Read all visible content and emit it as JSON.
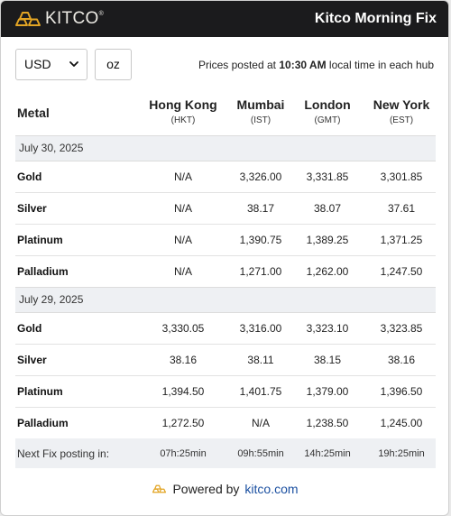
{
  "header": {
    "logo_text": "KITCO",
    "logo_mark": "®",
    "title": "Kitco Morning Fix"
  },
  "controls": {
    "currency": "USD",
    "unit": "oz",
    "notice_prefix": "Prices posted at ",
    "notice_time": "10:30 AM",
    "notice_suffix": " local time in each hub"
  },
  "table": {
    "metal_header": "Metal",
    "cities": [
      {
        "name": "Hong Kong",
        "tz": "(HKT)"
      },
      {
        "name": "Mumbai",
        "tz": "(IST)"
      },
      {
        "name": "London",
        "tz": "(GMT)"
      },
      {
        "name": "New York",
        "tz": "(EST)"
      }
    ],
    "groups": [
      {
        "date": "July 30, 2025",
        "rows": [
          {
            "metal": "Gold",
            "values": [
              "N/A",
              "3,326.00",
              "3,331.85",
              "3,301.85"
            ]
          },
          {
            "metal": "Silver",
            "values": [
              "N/A",
              "38.17",
              "38.07",
              "37.61"
            ]
          },
          {
            "metal": "Platinum",
            "values": [
              "N/A",
              "1,390.75",
              "1,389.25",
              "1,371.25"
            ]
          },
          {
            "metal": "Palladium",
            "values": [
              "N/A",
              "1,271.00",
              "1,262.00",
              "1,247.50"
            ]
          }
        ]
      },
      {
        "date": "July 29, 2025",
        "rows": [
          {
            "metal": "Gold",
            "values": [
              "3,330.05",
              "3,316.00",
              "3,323.10",
              "3,323.85"
            ]
          },
          {
            "metal": "Silver",
            "values": [
              "38.16",
              "38.11",
              "38.15",
              "38.16"
            ]
          },
          {
            "metal": "Platinum",
            "values": [
              "1,394.50",
              "1,401.75",
              "1,379.00",
              "1,396.50"
            ]
          },
          {
            "metal": "Palladium",
            "values": [
              "1,272.50",
              "N/A",
              "1,238.50",
              "1,245.00"
            ]
          }
        ]
      }
    ],
    "next_fix_label": "Next Fix posting in:",
    "next_fix": [
      "07h:25min",
      "09h:55min",
      "14h:25min",
      "19h:25min"
    ]
  },
  "footer": {
    "prefix": "Powered by",
    "link": "kitco.com"
  },
  "colors": {
    "header_bg": "#1b1b1d",
    "gold_accent": "#e3a524",
    "row_shade": "#eef0f3",
    "link": "#1a4fa0"
  },
  "icons": {
    "logo": "gold-bars-icon",
    "select_arrow": "chevron-down-icon",
    "footer": "gold-bars-icon"
  }
}
